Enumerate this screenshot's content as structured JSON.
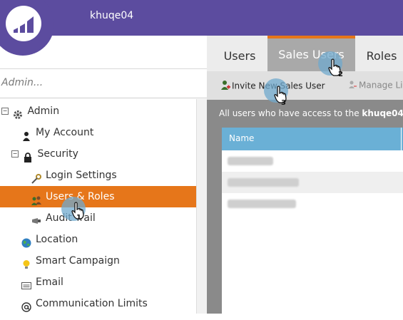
{
  "header": {
    "workspace_name": "khuqe04",
    "logo_icon": "marketo-logo-icon",
    "background": "#5c4c9f"
  },
  "admin_search": {
    "placeholder": "Admin..."
  },
  "tree": {
    "root": {
      "label": "Admin",
      "icon": "gear-icon"
    },
    "items": [
      {
        "label": "My Account",
        "icon": "person-icon"
      },
      {
        "label": "Security",
        "icon": "lock-icon"
      },
      {
        "label": "Login Settings",
        "icon": "key-icon"
      },
      {
        "label": "Users & Roles",
        "icon": "users-icon",
        "selected": true
      },
      {
        "label": "Audit Trail",
        "icon": "audit-trail-icon"
      },
      {
        "label": "Location",
        "icon": "globe-icon"
      },
      {
        "label": "Smart Campaign",
        "icon": "lightbulb-icon"
      },
      {
        "label": "Email",
        "icon": "email-icon"
      },
      {
        "label": "Communication Limits",
        "icon": "at-sign-icon"
      }
    ],
    "selected_color": "#e6761a"
  },
  "tabs": [
    {
      "label": "Users"
    },
    {
      "label": "Sales Users",
      "active": true
    },
    {
      "label": "Roles"
    }
  ],
  "toolbar": {
    "invite_label": "Invite New Sales User",
    "manage_label": "Manage Li"
  },
  "info": {
    "prefix": "All users who have access to the ",
    "workspace": "khuqe04"
  },
  "grid": {
    "columns": [
      "Name"
    ],
    "header_color": "#6ab0d6"
  },
  "steps": [
    "1",
    "2",
    "3"
  ]
}
